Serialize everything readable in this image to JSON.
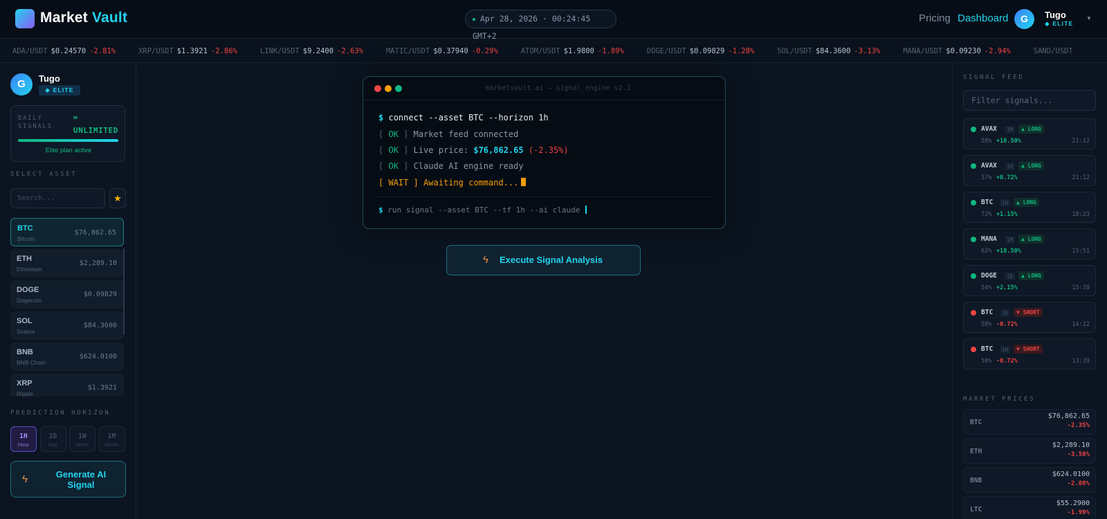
{
  "header": {
    "brand_part1": "Market",
    "brand_part2": "Vault",
    "datetime": "Apr 28, 2026 · 00:24:45 GMT+2",
    "nav_pricing": "Pricing",
    "nav_dashboard": "Dashboard",
    "user_initial": "G",
    "username": "Tugo",
    "user_badge": "ELITE"
  },
  "ticker": [
    {
      "symbol": "ADA/USDT",
      "price": "$0.24570",
      "change": "-2.81%"
    },
    {
      "symbol": "XRP/USDT",
      "price": "$1.3921",
      "change": "-2.86%"
    },
    {
      "symbol": "LINK/USDT",
      "price": "$9.2400",
      "change": "-2.63%"
    },
    {
      "symbol": "MATIC/USDT",
      "price": "$0.37940",
      "change": "-0.29%"
    },
    {
      "symbol": "ATOM/USDT",
      "price": "$1.9800",
      "change": "-1.89%"
    },
    {
      "symbol": "DOGE/USDT",
      "price": "$0.09829",
      "change": "-1.28%"
    },
    {
      "symbol": "SOL/USDT",
      "price": "$84.3600",
      "change": "-3.13%"
    },
    {
      "symbol": "MANA/USDT",
      "price": "$0.09230",
      "change": "-2.94%"
    },
    {
      "symbol": "SAND/USDT",
      "price": "",
      "change": ""
    }
  ],
  "sidebar": {
    "user_initial": "G",
    "username": "Tugo",
    "badge": "ELITE",
    "daily_label": "DAILY SIGNALS",
    "daily_infinity": "∞",
    "daily_value": "UNLIMITED",
    "daily_progress": 1.0,
    "daily_note": "Elite plan active",
    "select_asset_label": "SELECT ASSET",
    "search_placeholder": "Search...",
    "assets": [
      {
        "symbol": "BTC",
        "name": "Bitcoin",
        "price": "$76,862.65",
        "selected": true
      },
      {
        "symbol": "ETH",
        "name": "Ethereum",
        "price": "$2,289.10",
        "selected": false
      },
      {
        "symbol": "DOGE",
        "name": "Dogecoin",
        "price": "$0.09829",
        "selected": false
      },
      {
        "symbol": "SOL",
        "name": "Solana",
        "price": "$84.3600",
        "selected": false
      },
      {
        "symbol": "BNB",
        "name": "BNB Chain",
        "price": "$624.0100",
        "selected": false
      },
      {
        "symbol": "XRP",
        "name": "Ripple",
        "price": "$1.3921",
        "selected": false
      }
    ],
    "horizon_label": "PREDICTION HORIZON",
    "horizons": [
      {
        "key": "1H",
        "sub": "Hour",
        "active": true
      },
      {
        "key": "1D",
        "sub": "Day",
        "active": false
      },
      {
        "key": "1W",
        "sub": "Week",
        "active": false
      },
      {
        "key": "1M",
        "sub": "Month",
        "active": false
      }
    ],
    "generate_label": "Generate AI Signal"
  },
  "terminal": {
    "title": "marketvault.ai — signal_engine v2.1",
    "prompt": "$",
    "command": "connect --asset BTC --horizon 1h",
    "ok_tag": "OK",
    "line_feed": "Market feed connected",
    "line_price_label": "Live price:",
    "line_price_value": "$76,862.65",
    "line_price_change": "(-2.35%)",
    "line_engine": "Claude AI engine ready",
    "wait_tag": "WAIT",
    "line_wait": "Awaiting command...",
    "input_command": "run signal --asset BTC --tf 1h --ai claude"
  },
  "execute_label": "Execute Signal Analysis",
  "signal_feed": {
    "label": "SIGNAL FEED",
    "filter_placeholder": "Filter signals...",
    "items": [
      {
        "symbol": "AVAX",
        "tf": "1M",
        "direction": "LONG",
        "confidence": "58%",
        "change": "+18.50%",
        "time": "21:12"
      },
      {
        "symbol": "AVAX",
        "tf": "1H",
        "direction": "LONG",
        "confidence": "57%",
        "change": "+0.72%",
        "time": "21:12"
      },
      {
        "symbol": "BTC",
        "tf": "1H",
        "direction": "LONG",
        "confidence": "72%",
        "change": "+1.15%",
        "time": "18:23"
      },
      {
        "symbol": "MANA",
        "tf": "1M",
        "direction": "LONG",
        "confidence": "62%",
        "change": "+18.50%",
        "time": "15:51"
      },
      {
        "symbol": "DOGE",
        "tf": "1D",
        "direction": "LONG",
        "confidence": "54%",
        "change": "+2.15%",
        "time": "15:38"
      },
      {
        "symbol": "BTC",
        "tf": "1H",
        "direction": "SHORT",
        "confidence": "58%",
        "change": "-0.72%",
        "time": "14:22"
      },
      {
        "symbol": "BTC",
        "tf": "1H",
        "direction": "SHORT",
        "confidence": "58%",
        "change": "-0.72%",
        "time": "13:39"
      }
    ]
  },
  "market_prices": {
    "label": "MARKET PRICES",
    "items": [
      {
        "symbol": "BTC",
        "price": "$76,862.65",
        "change": "-2.35%"
      },
      {
        "symbol": "ETH",
        "price": "$2,289.10",
        "change": "-3.58%"
      },
      {
        "symbol": "BNB",
        "price": "$624.0100",
        "change": "-2.08%"
      },
      {
        "symbol": "LTC",
        "price": "$55.2900",
        "change": "-1.99%"
      }
    ]
  },
  "colors": {
    "accent": "#22d3ee",
    "positive": "#10b981",
    "negative": "#ef4444",
    "warning": "#f59e0b",
    "purple": "#8b5cf6"
  }
}
